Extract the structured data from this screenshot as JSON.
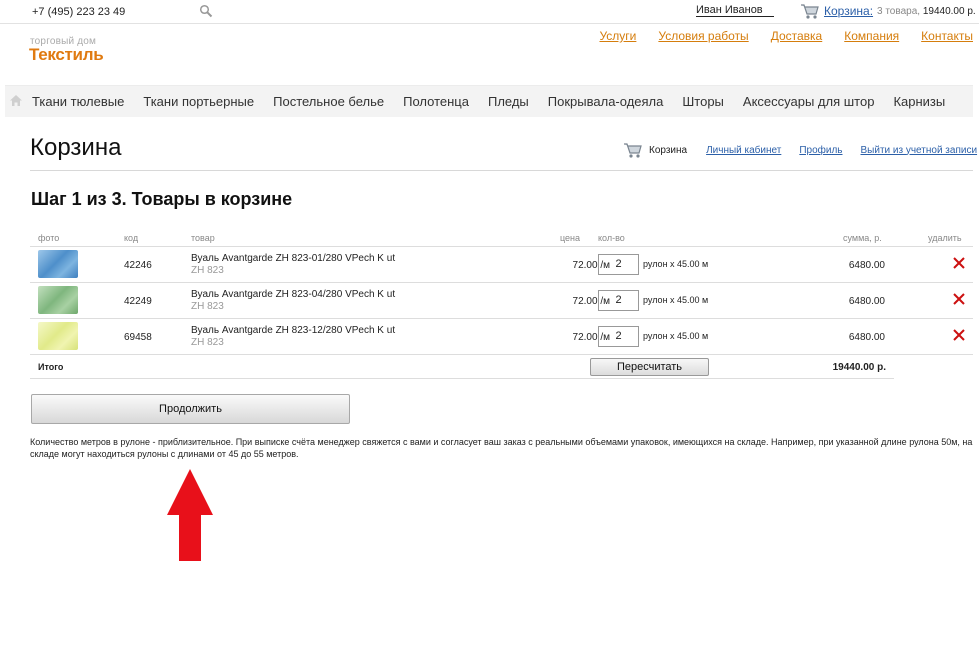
{
  "topbar": {
    "phone": "+7 (495) 223 23 49",
    "user_name": "Иван Иванов",
    "cart_link": "Корзина:",
    "cart_count": "3 товара,",
    "cart_total": "19440.00 р."
  },
  "logo": {
    "small": "торговый дом",
    "big": "Текстиль"
  },
  "toplinks": [
    "Услуги",
    "Условия работы",
    "Доставка",
    "Компания",
    "Контакты"
  ],
  "nav": [
    "Ткани тюлевые",
    "Ткани портьерные",
    "Постельное белье",
    "Полотенца",
    "Пледы",
    "Покрывала-одеяла",
    "Шторы",
    "Аксессуары для штор",
    "Карнизы"
  ],
  "page": {
    "title": "Корзина",
    "step_title": "Шаг 1 из 3. Товары в корзине",
    "account": {
      "cart_label": "Корзина",
      "cabinet": "Личный кабинет",
      "profile": "Профиль",
      "logout": "Выйти из учетной записи"
    }
  },
  "table": {
    "headers": {
      "photo": "фото",
      "code": "код",
      "product": "товар",
      "price": "цена",
      "qty": "кол-во",
      "sum": "сумма, р.",
      "delete": "удалить"
    },
    "rows": [
      {
        "code": "42246",
        "name": "Вуаль Avantgarde ZH 823-01/280 VPech K ut",
        "article": "ZH 823",
        "price": "72.00 /м",
        "qty": "2",
        "unit": "рулон х 45.00 м",
        "sum": "6480.00",
        "thumb_color": "#5b9ccf"
      },
      {
        "code": "42249",
        "name": "Вуаль Avantgarde ZH 823-04/280 VPech K ut",
        "article": "ZH 823",
        "price": "72.00 /м",
        "qty": "2",
        "unit": "рулон х 45.00 м",
        "sum": "6480.00",
        "thumb_color": "#8cc08c"
      },
      {
        "code": "69458",
        "name": "Вуаль Avantgarde ZH 823-12/280 VPech K ut",
        "article": "ZH 823",
        "price": "72.00 /м",
        "qty": "2",
        "unit": "рулон х 45.00 м",
        "sum": "6480.00",
        "thumb_color": "#e6ee9a"
      }
    ],
    "total_label": "Итого",
    "recalc_label": "Пересчитать",
    "total_value": "19440.00 р."
  },
  "continue_label": "Продолжить",
  "note": "Количество метров в рулоне - приблизительное. При выписке счёта менеджер свяжется с вами и согласует ваш заказ с реальными объемами упаковок, имеющихся на складе. Например, при указанной длине рулона 50м, на складе могут находиться рулоны с длинами от 45 до 55 метров.",
  "colors": {
    "accent_orange": "#e07a10",
    "link_blue": "#2b5fa8",
    "delete_red": "#cc1111",
    "arrow_red": "#e8101a"
  },
  "icons": {
    "search": "search-icon",
    "cart": "cart-icon",
    "home": "home-icon",
    "delete": "delete-icon",
    "annotation": "up-arrow-annotation"
  }
}
